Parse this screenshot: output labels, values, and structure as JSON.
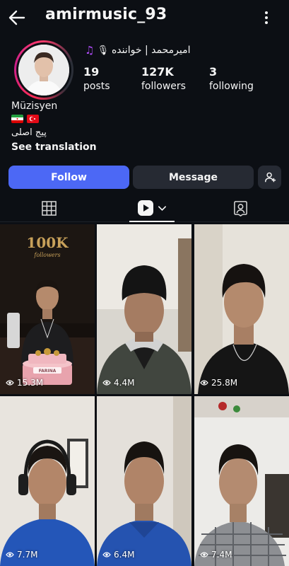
{
  "header": {
    "username": "amirmusic_93"
  },
  "profile": {
    "bio_name": "امیرمحمد | خواننده",
    "stats": [
      {
        "value": "19",
        "label": "posts"
      },
      {
        "value": "127K",
        "label": "followers"
      },
      {
        "value": "3",
        "label": "following"
      }
    ],
    "category": "Müzisyen",
    "bio_line": "پیج اصلی",
    "see_translation": "See translation"
  },
  "actions": {
    "follow": "Follow",
    "message": "Message"
  },
  "cake_text": {
    "badge": "100K",
    "badge_sub": "followers",
    "name": "FARINA"
  },
  "reels": [
    {
      "views": "15.3M"
    },
    {
      "views": "4.4M"
    },
    {
      "views": "25.8M"
    },
    {
      "views": "7.7M"
    },
    {
      "views": "6.4M"
    },
    {
      "views": "7.4M"
    }
  ],
  "colors": {
    "follow": "#4c68f5",
    "background": "#0c0f14",
    "button": "#262a33"
  }
}
